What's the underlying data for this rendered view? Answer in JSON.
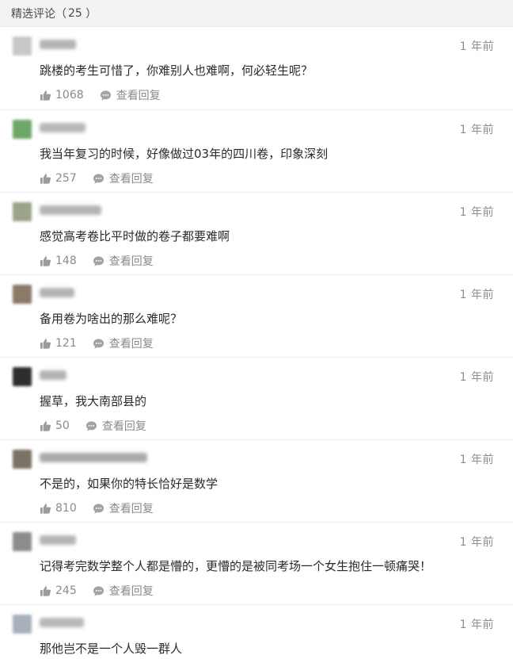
{
  "header": {
    "title": "精选评论",
    "count": "25"
  },
  "comments": [
    {
      "text": "跳楼的考生可惜了，你难别人也难啊，何必轻生呢？",
      "time": "1 年前",
      "likes": "1068",
      "reply_label": "查看回复",
      "avatar_color": "#c8c8c8",
      "nick_color": "#9a9a9a"
    },
    {
      "text": "我当年复习的时候，好像做过03年的四川卷，印象深刻",
      "time": "1 年前",
      "likes": "257",
      "reply_label": "查看回复",
      "avatar_color": "#6ea869",
      "nick_color": "#a0a0a0"
    },
    {
      "text": "感觉高考卷比平时做的卷子都要难啊",
      "time": "1 年前",
      "likes": "148",
      "reply_label": "查看回复",
      "avatar_color": "#9aa486",
      "nick_color": "#9b9b9b"
    },
    {
      "text": "备用卷为啥出的那么难呢？",
      "time": "1 年前",
      "likes": "121",
      "reply_label": "查看回复",
      "avatar_color": "#8a7a68",
      "nick_color": "#999999"
    },
    {
      "text": "握草，我大南部县的",
      "time": "1 年前",
      "likes": "50",
      "reply_label": "查看回复",
      "avatar_color": "#2e2e2e",
      "nick_color": "#999999"
    },
    {
      "text": "不是的，如果你的特长恰好是数学",
      "time": "1 年前",
      "likes": "810",
      "reply_label": "查看回复",
      "avatar_color": "#7a7264",
      "nick_color": "#8f8f8f"
    },
    {
      "text": "记得考完数学整个人都是懵的，更懵的是被同考场一个女生抱住一顿痛哭！",
      "time": "1 年前",
      "likes": "245",
      "reply_label": "查看回复",
      "avatar_color": "#8c8c8c",
      "nick_color": "#9c9c9c"
    },
    {
      "text": "那他岂不是一个人毁一群人",
      "time": "1 年前",
      "likes": "",
      "reply_label": "",
      "avatar_color": "#a8b0bc",
      "nick_color": "#a0a0a0"
    }
  ]
}
